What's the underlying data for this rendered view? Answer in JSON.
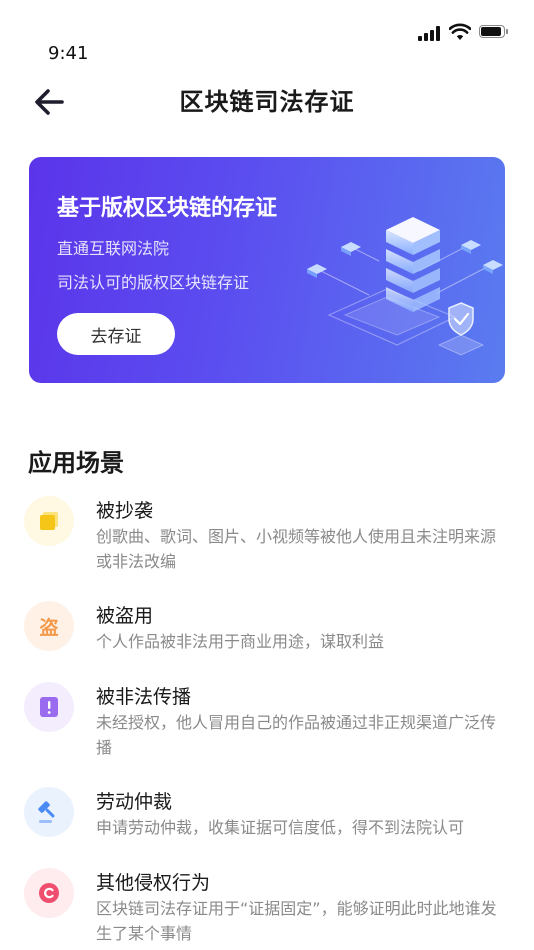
{
  "status_bar": {
    "time": "9:41"
  },
  "nav": {
    "title": "区块链司法存证"
  },
  "banner": {
    "title": "基于版权区块链的存证",
    "subtitle_1": "直通互联网法院",
    "subtitle_2": "司法认可的版权区块链存证",
    "button_label": "去存证"
  },
  "section": {
    "title": "应用场景"
  },
  "scenes": [
    {
      "title": "被抄袭",
      "desc": "创歌曲、歌词、图片、小视频等被他人使用且未注明来源或非法改编",
      "icon": "copy-squares-icon",
      "color": "#f5c518",
      "bg": "#fff8e2"
    },
    {
      "title": "被盗用",
      "desc": "个人作品被非法用于商业用途，谋取利益",
      "icon": "steal-character-icon",
      "glyph": "盗",
      "color": "#f29a4a",
      "bg": "#fff1e6"
    },
    {
      "title": "被非法传播",
      "desc": "未经授权，他人冒用自己的作品被通过非正规渠道广泛传播",
      "icon": "alert-document-icon",
      "color": "#9b6bef",
      "bg": "#f3edfd"
    },
    {
      "title": "劳动仲裁",
      "desc": "申请劳动仲裁，收集证据可信度低，得不到法院认可",
      "icon": "gavel-icon",
      "color": "#4a8af4",
      "bg": "#eaf2fe"
    },
    {
      "title": "其他侵权行为",
      "desc": "区块链司法存证用于“证据固定”，能够证明此时此地谁发生了某个事情",
      "icon": "copyright-icon",
      "color": "#f04e6e",
      "bg": "#feecef"
    }
  ]
}
